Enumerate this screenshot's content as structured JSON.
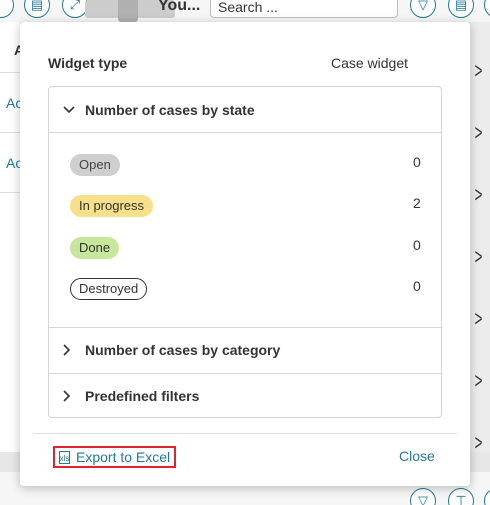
{
  "background": {
    "page_title": "You...",
    "search_placeholder": "Search ...",
    "left_column_header": "A",
    "left_links": [
      "Ac",
      "Ac"
    ]
  },
  "modal": {
    "widget_type_label": "Widget type",
    "widget_type_value": "Case widget",
    "sections": [
      {
        "label": "Number of cases by state",
        "expanded": true
      },
      {
        "label": "Number of cases by category",
        "expanded": false
      },
      {
        "label": "Predefined filters",
        "expanded": false
      }
    ],
    "states": [
      {
        "name": "Open",
        "count": "0",
        "color": "#cfcfcf"
      },
      {
        "name": "In progress",
        "count": "2",
        "color": "#f6e08a"
      },
      {
        "name": "Done",
        "count": "0",
        "color": "#c7e89a"
      },
      {
        "name": "Destroyed",
        "count": "0",
        "color": "#ffffff"
      }
    ],
    "export_label": "Export to Excel",
    "export_icon_text": "xls",
    "close_label": "Close"
  },
  "colors": {
    "accent": "#1f7a9a",
    "highlight_border": "#e0232e"
  }
}
